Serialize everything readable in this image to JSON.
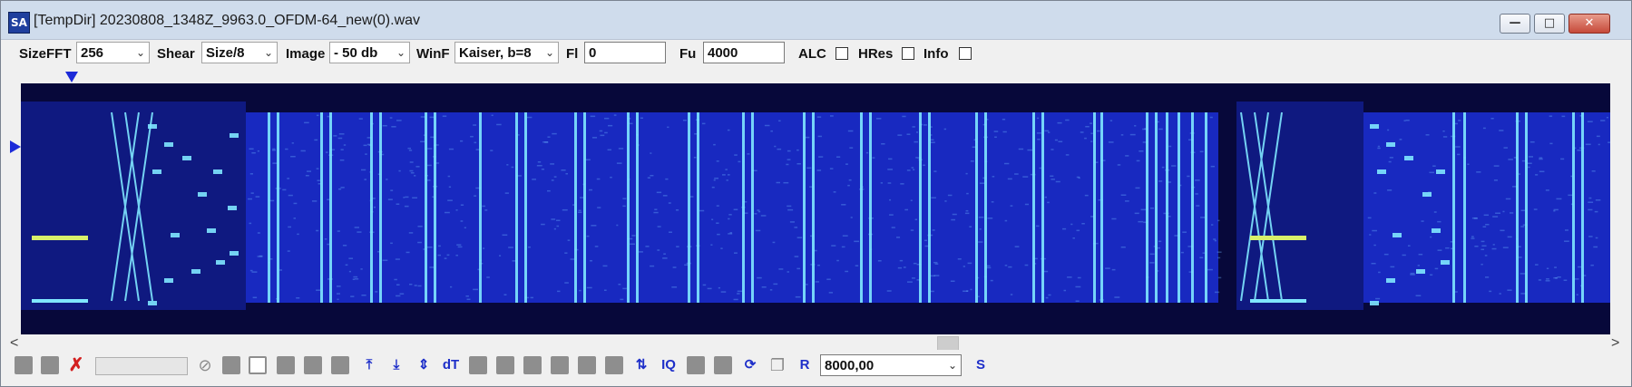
{
  "window": {
    "title": "[TempDir] 20230808_1348Z_9963.0_OFDM-64_new(0).wav",
    "app_icon_text": "SA",
    "buttons": {
      "minimize": "—",
      "maximize": "□",
      "close": "✕"
    }
  },
  "toolbar": {
    "sizefft_label": "SizeFFT",
    "sizefft_value": "256",
    "shear_label": "Shear",
    "shear_value": "Size/8",
    "image_label": "Image",
    "image_value": "- 50 db",
    "winf_label": "WinF",
    "winf_value": "Kaiser, b=8",
    "fl_label": "Fl",
    "fl_value": "0",
    "fu_label": "Fu",
    "fu_value": "4000",
    "alc_label": "ALC",
    "hres_label": "HRes",
    "info_label": "Info",
    "alc_checked": false,
    "hres_checked": false,
    "info_checked": false
  },
  "spectrogram": {
    "background_color": "#07083a",
    "noise_color": "#1b2fd8",
    "line_color": "#7fe7ff",
    "tone_color": "#d8f06a"
  },
  "scrollbar": {
    "left_arrow": "<",
    "right_arrow": ">"
  },
  "bottom_toolbar": {
    "icons": [
      "page-icon",
      "page-icon",
      "no-cross-icon",
      "progress-field",
      "no-entry-icon",
      "page-icon",
      "frame-icon",
      "page-icon",
      "page-icon",
      "page-icon",
      "zoom-in-icon",
      "zoom-out-icon",
      "zoom-fit-icon",
      "dt-icon",
      "page-icon",
      "page-icon",
      "page-icon",
      "page-icon",
      "page-icon",
      "page-icon",
      "swap-icon",
      "iq-icon",
      "page-icon",
      "page-icon",
      "refresh-icon",
      "copy-icon",
      "r-icon",
      "s-icon"
    ],
    "zoom_in_label": "⋄",
    "dt_label": "dT",
    "iq_label": "IQ",
    "r_label": "R",
    "s_label": "S",
    "rate_value": "8000,00"
  }
}
